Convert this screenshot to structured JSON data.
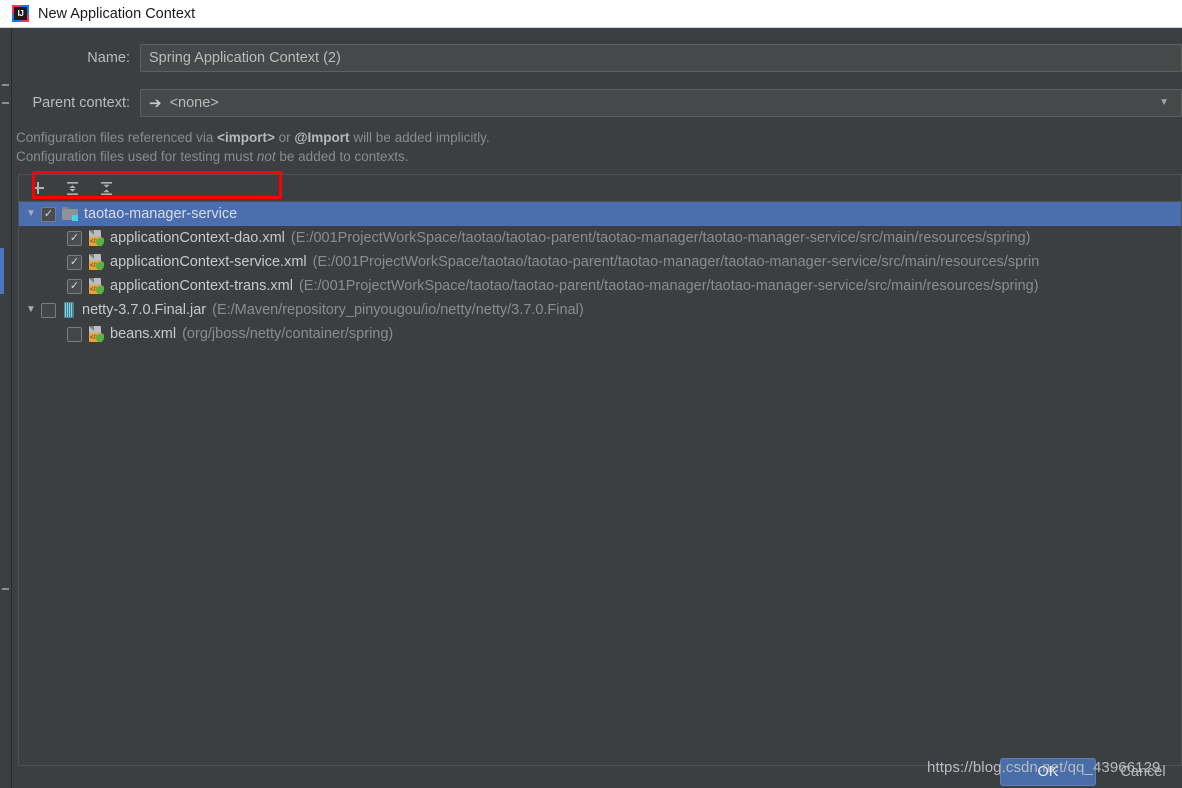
{
  "window": {
    "title": "New Application Context",
    "logo_icon": "intellij-idea-logo"
  },
  "form": {
    "name_label": "Name:",
    "name_value": "Spring Application Context (2)",
    "name_placeholder": "Spring Application Context",
    "parent_label": "Parent context:",
    "parent_value": "<none>",
    "parent_arrow_icon": "arrow-right-icon",
    "parent_dropdown_icon": "chevron-down-icon"
  },
  "hints": {
    "line1_part1": "Configuration files referenced via ",
    "line1_bold1": "<import>",
    "line1_part2": " or ",
    "line1_bold2": "@Import",
    "line1_part3": " will be added implicitly.",
    "line2_part1": "Configuration files used for testing must ",
    "line2_italic": "not",
    "line2_part2": " be added to contexts."
  },
  "toolbar": {
    "add_label": "+",
    "add_icon": "plus-icon",
    "expand_all_icon": "expand-all-icon",
    "collapse_all_icon": "collapse-all-icon"
  },
  "tree": {
    "rows": [
      {
        "id": "taotao-manager-service",
        "depth": 0,
        "twisty": "▼",
        "checked": true,
        "icon": "module-folder-icon",
        "label": "taotao-manager-service",
        "path": "",
        "selected": true,
        "annotated": true
      },
      {
        "id": "applicationContext-dao.xml",
        "depth": 1,
        "twisty": "",
        "checked": true,
        "icon": "spring-xml-file-icon",
        "label": "applicationContext-dao.xml",
        "path": "(E:/001ProjectWorkSpace/taotao/taotao-parent/taotao-manager/taotao-manager-service/src/main/resources/spring)",
        "selected": false,
        "annotated": false
      },
      {
        "id": "applicationContext-service.xml",
        "depth": 1,
        "twisty": "",
        "checked": true,
        "icon": "spring-xml-file-icon",
        "label": "applicationContext-service.xml",
        "path": "(E:/001ProjectWorkSpace/taotao/taotao-parent/taotao-manager/taotao-manager-service/src/main/resources/sprin",
        "selected": false,
        "annotated": false
      },
      {
        "id": "applicationContext-trans.xml",
        "depth": 1,
        "twisty": "",
        "checked": true,
        "icon": "spring-xml-file-icon",
        "label": "applicationContext-trans.xml",
        "path": "(E:/001ProjectWorkSpace/taotao/taotao-parent/taotao-manager/taotao-manager-service/src/main/resources/spring)",
        "selected": false,
        "annotated": false
      },
      {
        "id": "netty-3.7.0.Final.jar",
        "depth": 0,
        "twisty": "▼",
        "checked": false,
        "icon": "jar-library-icon",
        "label": "netty-3.7.0.Final.jar",
        "path": "(E:/Maven/repository_pinyougou/io/netty/netty/3.7.0.Final)",
        "selected": false,
        "annotated": false
      },
      {
        "id": "beans.xml",
        "depth": 1,
        "twisty": "",
        "checked": false,
        "icon": "spring-xml-file-icon",
        "label": "beans.xml",
        "path": "(org/jboss/netty/container/spring)",
        "selected": false,
        "annotated": false
      }
    ]
  },
  "footer": {
    "ok_label": "OK",
    "cancel_label": "Cancel"
  },
  "watermark": {
    "text": "https://blog.csdn.net/qq_43966129"
  },
  "colors": {
    "dialog_bg": "#3c3f41",
    "field_bg": "#45494a",
    "selection_blue": "#4b6eaf",
    "ok_button_blue": "#4a6da7",
    "annotation_red": "#ff0000",
    "text_primary": "#c7c9ca",
    "text_secondary": "#8a8d8e"
  }
}
